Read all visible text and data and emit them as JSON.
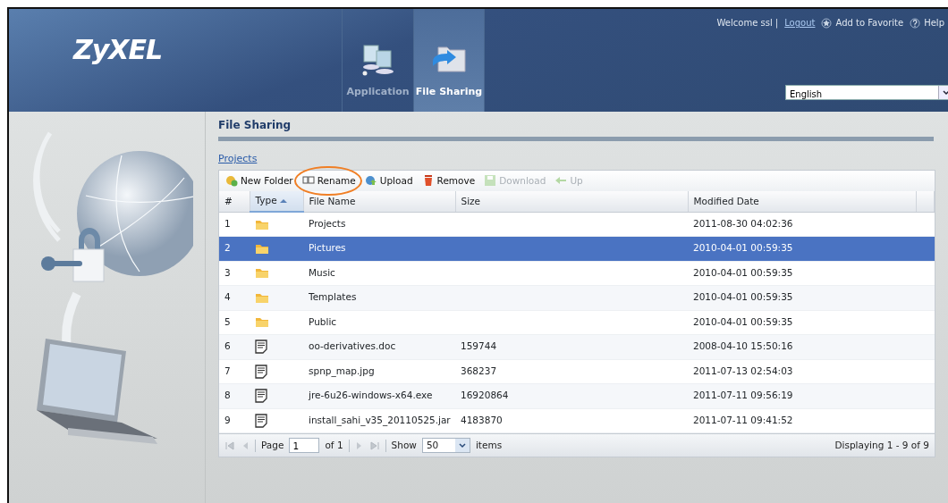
{
  "header": {
    "logo": "ZyXEL",
    "tabs": [
      {
        "label": "Application",
        "selected": false,
        "kind": "computers"
      },
      {
        "label": "File Sharing",
        "selected": true,
        "kind": "folder"
      }
    ],
    "welcome": "Welcome ssl |",
    "logout": "Logout",
    "favorite": "Add to Favorite",
    "help": "Help",
    "language": "English"
  },
  "section_title": "File Sharing",
  "breadcrumb": "Projects",
  "toolbar": [
    {
      "label": "New Folder",
      "kind": "new-folder",
      "disabled": false,
      "circled": false
    },
    {
      "label": "Rename",
      "kind": "rename",
      "disabled": false,
      "circled": true
    },
    {
      "label": "Upload",
      "kind": "upload",
      "disabled": false,
      "circled": false
    },
    {
      "label": "Remove",
      "kind": "remove",
      "disabled": false,
      "circled": false
    },
    {
      "label": "Download",
      "kind": "download",
      "disabled": true,
      "circled": false
    },
    {
      "label": "Up",
      "kind": "up",
      "disabled": true,
      "circled": false
    }
  ],
  "table": {
    "columns": [
      {
        "label": "#",
        "sorted": false
      },
      {
        "label": "Type",
        "sorted": true
      },
      {
        "label": "File Name",
        "sorted": false
      },
      {
        "label": "Size",
        "sorted": false
      },
      {
        "label": "Modified Date",
        "sorted": false
      }
    ],
    "rows": [
      {
        "index": "1",
        "kind": "folder",
        "name": "Projects",
        "size": "",
        "modified": "2011-08-30 04:02:36",
        "selected": false
      },
      {
        "index": "2",
        "kind": "folder",
        "name": "Pictures",
        "modified": "2010-04-01 00:59:35",
        "selected": true
      },
      {
        "index": "3",
        "kind": "folder",
        "name": "Music",
        "modified": "2010-04-01 00:59:35",
        "selected": false
      },
      {
        "index": "4",
        "kind": "folder",
        "name": "Templates",
        "modified": "2010-04-01 00:59:35",
        "selected": false
      },
      {
        "index": "5",
        "kind": "folder",
        "name": "Public",
        "modified": "2010-04-01 00:59:35",
        "selected": false
      },
      {
        "index": "6",
        "kind": "file",
        "name": "oo-derivatives.doc",
        "size": "159744",
        "modified": "2008-04-10 15:50:16",
        "selected": false
      },
      {
        "index": "7",
        "kind": "file",
        "name": "spnp_map.jpg",
        "size": "368237",
        "modified": "2011-07-13 02:54:03",
        "selected": false
      },
      {
        "index": "8",
        "kind": "file",
        "name": "jre-6u26-windows-x64.exe",
        "size": "16920864",
        "modified": "2011-07-11 09:56:19",
        "selected": false
      },
      {
        "index": "9",
        "kind": "file",
        "name": "install_sahi_v35_20110525.jar",
        "size": "4183870",
        "modified": "2011-07-11 09:41:52",
        "selected": false
      }
    ]
  },
  "pager": {
    "page_label": "Page",
    "page": "1",
    "of": "of 1",
    "show_label": "Show",
    "show": "50",
    "items_label": "items",
    "displaying": "Displaying 1 - 9 of 9"
  }
}
